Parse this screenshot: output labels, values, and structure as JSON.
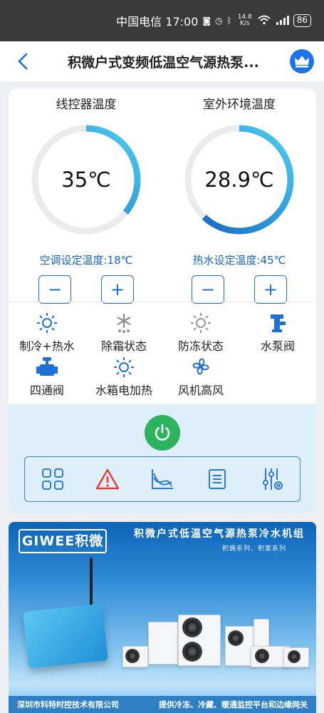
{
  "status_bar": {
    "carrier_time": "中国电信 17:00",
    "net_speed": "14.8 K/s",
    "battery": "86",
    "icons": [
      "nfc-icon",
      "alarm-icon",
      "bluetooth-icon",
      "speed-icon",
      "wifi-icon",
      "signal-icon",
      "battery-icon"
    ]
  },
  "header": {
    "title": "积微户式变频低温空气源热泵...",
    "back_icon": "chevron-left-icon",
    "crown_icon": "crown-icon"
  },
  "gauges": [
    {
      "label": "线控器温度",
      "value": "35℃",
      "setpoint": "空调设定温度:18℃",
      "arc_fraction": 0.36,
      "minus": "−",
      "plus": "+"
    },
    {
      "label": "室外环境温度",
      "value": "28.9℃",
      "setpoint": "热水设定温度:45℃",
      "arc_fraction": 0.62,
      "minus": "−",
      "plus": "+"
    }
  ],
  "status_items": [
    {
      "label": "制冷+热水",
      "icon": "sun-icon"
    },
    {
      "label": "除霜状态",
      "icon": "snowflake-icon"
    },
    {
      "label": "防冻状态",
      "icon": "sun-outline-icon"
    },
    {
      "label": "水泵阀",
      "icon": "pump-valve-icon"
    },
    {
      "label": "四通阀",
      "icon": "four-way-valve-icon"
    },
    {
      "label": "水箱电加热",
      "icon": "sun-icon"
    },
    {
      "label": "风机高风",
      "icon": "fan-icon"
    }
  ],
  "colors": {
    "accent": "#1e6fd6",
    "power": "#2db35d",
    "warning": "#e53935",
    "arc_start": "#1565c0",
    "arc_end": "#4dd0f0",
    "track": "#ebebeb"
  },
  "toolbar": [
    "grid-icon",
    "warning-icon",
    "chart-icon",
    "list-icon",
    "settings-sliders-icon"
  ],
  "banner": {
    "brand": "GIWEE积微",
    "title": "积微户式低温空气源热泵冷水机组",
    "subtitle": "积熵系列、积家系列",
    "footer_left": "深圳市科特时控技术有限公司",
    "footer_right": "提供冷冻、冷藏、暖通监控平台和边缘网关"
  }
}
